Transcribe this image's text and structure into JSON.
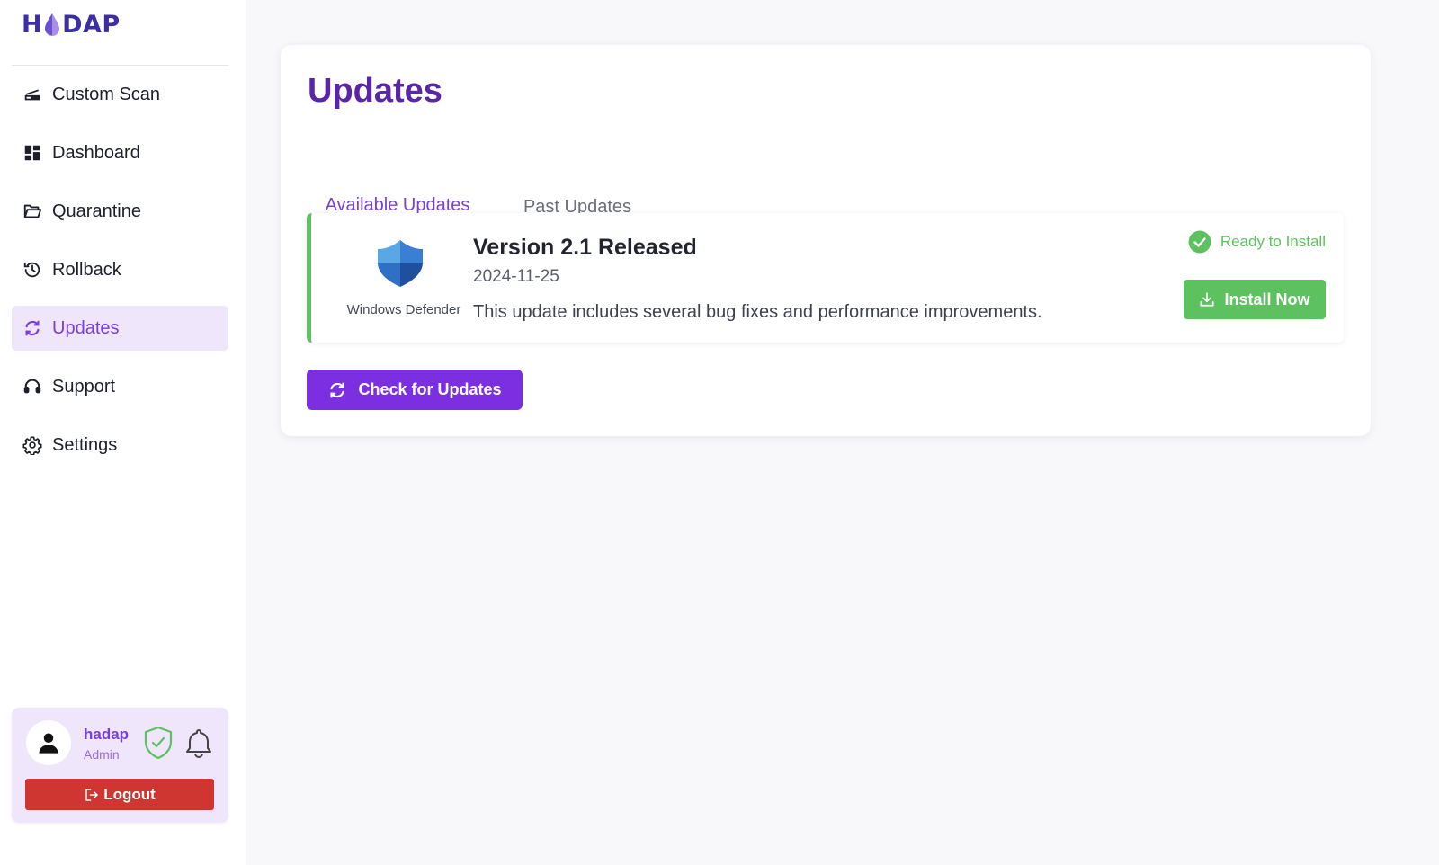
{
  "app": {
    "logo_text_left": "H",
    "logo_text_right": "DAP"
  },
  "sidebar": {
    "items": [
      {
        "label": "Custom Scan",
        "icon": "scanner-icon",
        "active": false
      },
      {
        "label": "Dashboard",
        "icon": "dashboard-icon",
        "active": false
      },
      {
        "label": "Quarantine",
        "icon": "folder-open-icon",
        "active": false
      },
      {
        "label": "Rollback",
        "icon": "history-icon",
        "active": false
      },
      {
        "label": "Updates",
        "icon": "sync-icon",
        "active": true
      },
      {
        "label": "Support",
        "icon": "headset-icon",
        "active": false
      },
      {
        "label": "Settings",
        "icon": "gear-icon",
        "active": false
      }
    ]
  },
  "user": {
    "name": "hadap",
    "role": "Admin",
    "logout_label": "Logout"
  },
  "main": {
    "title": "Updates",
    "tabs": [
      {
        "label": "Available Updates",
        "active": true
      },
      {
        "label": "Past Updates",
        "active": false
      }
    ],
    "update": {
      "vendor": "Windows Defender",
      "title": "Version 2.1 Released",
      "date": "2024-11-25",
      "description": "This update includes several bug fixes and performance improvements.",
      "status": "Ready to Install",
      "install_label": "Install Now"
    },
    "check_label": "Check for Updates"
  },
  "colors": {
    "accent": "#7a3fd6",
    "title": "#5b25a7",
    "success": "#5ec15f",
    "danger": "#cf3531",
    "active_bg": "#efe6fb"
  }
}
